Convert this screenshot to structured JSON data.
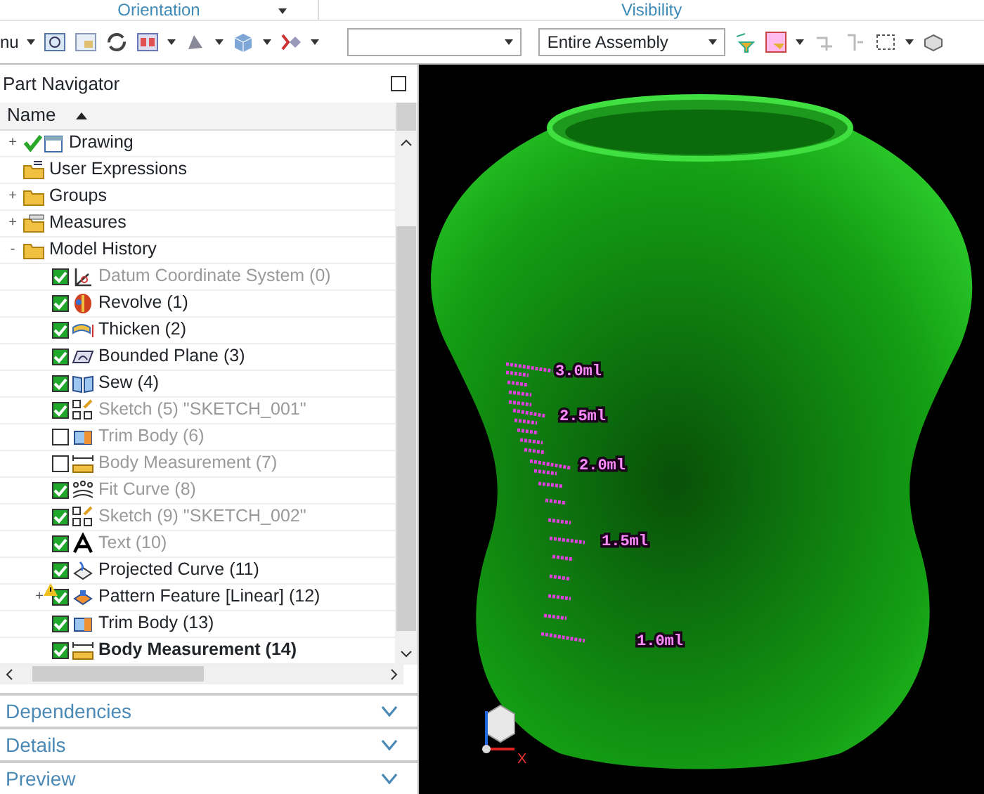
{
  "ribbon": {
    "groups": [
      "Orientation",
      "Visibility"
    ],
    "menu_fragment": "nu",
    "combo_2": {
      "value": "Entire Assembly"
    }
  },
  "navigator": {
    "title": "Part Navigator",
    "column": "Name",
    "nodes": [
      {
        "label": "Drawing",
        "kind": "drawing",
        "expander": "+"
      },
      {
        "label": "User Expressions",
        "kind": "expressions"
      },
      {
        "label": "Groups",
        "kind": "folder",
        "expander": "+"
      },
      {
        "label": "Measures",
        "kind": "measures",
        "expander": "+"
      },
      {
        "label": "Model History",
        "kind": "folder",
        "expander": "-",
        "children": [
          {
            "label": "Datum Coordinate System (0)",
            "kind": "datum",
            "checked": true,
            "dimmed": true,
            "current": false,
            "warning": false
          },
          {
            "label": "Revolve (1)",
            "kind": "revolve",
            "checked": true,
            "dimmed": false,
            "current": false,
            "warning": false
          },
          {
            "label": "Thicken (2)",
            "kind": "thicken",
            "checked": true,
            "dimmed": false,
            "current": false,
            "warning": false
          },
          {
            "label": "Bounded Plane (3)",
            "kind": "plane",
            "checked": true,
            "dimmed": false,
            "current": false,
            "warning": false
          },
          {
            "label": "Sew (4)",
            "kind": "sew",
            "checked": true,
            "dimmed": false,
            "current": false,
            "warning": false
          },
          {
            "label": "Sketch (5) \"SKETCH_001\"",
            "kind": "sketch",
            "checked": true,
            "dimmed": true,
            "current": false,
            "warning": false
          },
          {
            "label": "Trim Body (6)",
            "kind": "trim",
            "checked": false,
            "dimmed": true,
            "current": false,
            "warning": false
          },
          {
            "label": "Body Measurement (7)",
            "kind": "measure",
            "checked": false,
            "dimmed": true,
            "current": false,
            "warning": false
          },
          {
            "label": "Fit Curve (8)",
            "kind": "fit",
            "checked": true,
            "dimmed": true,
            "current": false,
            "warning": false
          },
          {
            "label": "Sketch (9) \"SKETCH_002\"",
            "kind": "sketch",
            "checked": true,
            "dimmed": true,
            "current": false,
            "warning": false
          },
          {
            "label": "Text (10)",
            "kind": "text",
            "checked": true,
            "dimmed": true,
            "current": false,
            "warning": false
          },
          {
            "label": "Projected Curve (11)",
            "kind": "project",
            "checked": true,
            "dimmed": false,
            "current": false,
            "warning": false
          },
          {
            "label": "Pattern Feature [Linear] (12)",
            "kind": "pattern",
            "checked": true,
            "dimmed": false,
            "current": false,
            "warning": true,
            "expander": "+"
          },
          {
            "label": "Trim Body (13)",
            "kind": "trim",
            "checked": true,
            "dimmed": false,
            "current": false,
            "warning": false
          },
          {
            "label": "Body Measurement (14)",
            "kind": "measure",
            "checked": true,
            "dimmed": false,
            "current": true,
            "warning": false
          }
        ]
      }
    ],
    "panels": [
      {
        "label": "Dependencies",
        "expanded": false
      },
      {
        "label": "Details",
        "expanded": false
      },
      {
        "label": "Preview",
        "expanded": false
      }
    ]
  },
  "viewport": {
    "scale_labels": [
      "3.0ml",
      "2.5ml",
      "2.0ml",
      "1.5ml",
      "1.0ml"
    ],
    "axis_label": "X"
  }
}
